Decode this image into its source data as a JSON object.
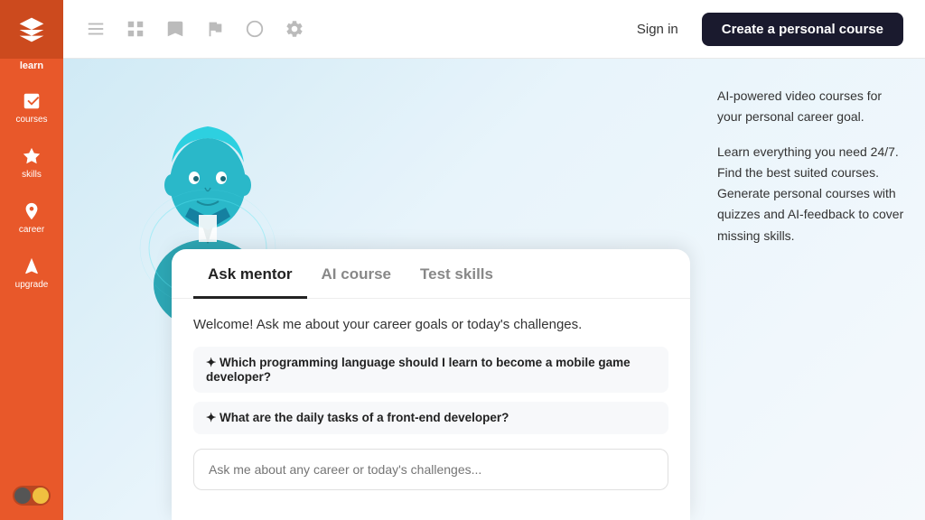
{
  "sidebar": {
    "logo_label": "learn",
    "items": [
      {
        "id": "courses",
        "label": "courses"
      },
      {
        "id": "skills",
        "label": "skills"
      },
      {
        "id": "career",
        "label": "career"
      },
      {
        "id": "upgrade",
        "label": "upgrade"
      }
    ]
  },
  "topnav": {
    "icons": [
      "menu-icon",
      "grid-icon",
      "bookmark-icon",
      "flag-icon",
      "circle-icon",
      "gear-icon"
    ],
    "sign_in_label": "Sign in",
    "create_course_label": "Create a personal course"
  },
  "chat_widget": {
    "tabs": [
      {
        "id": "ask-mentor",
        "label": "Ask mentor",
        "active": true
      },
      {
        "id": "ai-course",
        "label": "AI course",
        "active": false
      },
      {
        "id": "test-skills",
        "label": "Test skills",
        "active": false
      }
    ],
    "welcome_text": "Welcome! Ask me about your career goals or today's challenges.",
    "suggestions": [
      "✦ Which programming language should I learn to become a mobile game developer?",
      "✦ What are the daily tasks of a front-end developer?"
    ],
    "input_placeholder": "Ask me about any career or today's challenges..."
  },
  "right_panel": {
    "text1": "AI-powered video courses for your personal career goal.",
    "text2": "Learn everything you need 24/7. Find the best suited courses. Generate personal courses with quizzes and AI-feedback to cover missing skills."
  },
  "theme_toggle": {
    "state": "off"
  }
}
